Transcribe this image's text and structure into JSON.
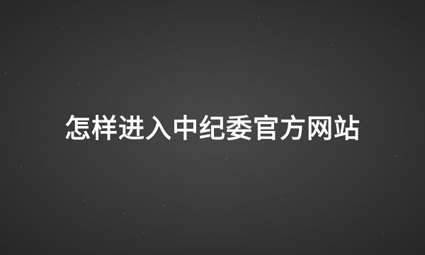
{
  "banner": {
    "title": "怎样进入中纪委官方网站",
    "background_color": "#3a3a3a",
    "text_color": "#ffffff"
  }
}
